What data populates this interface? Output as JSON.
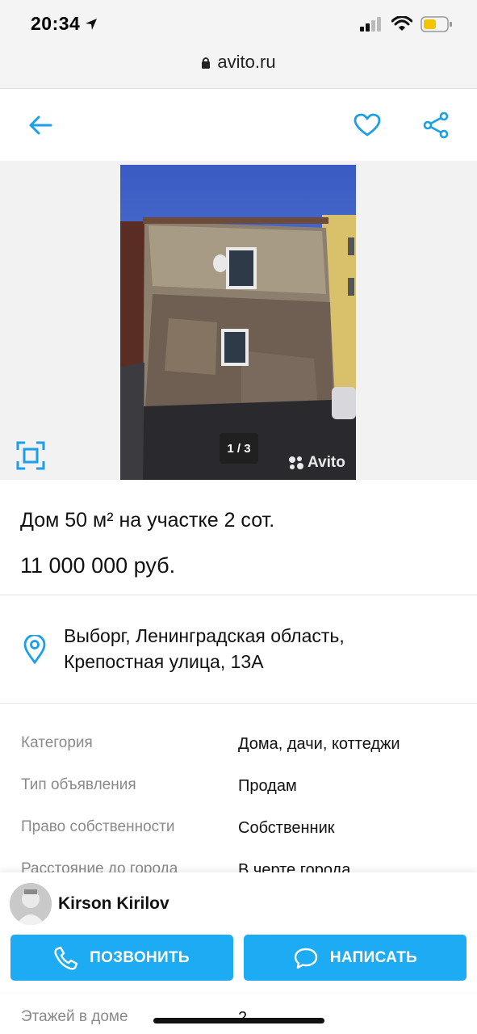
{
  "status_bar": {
    "time": "20:34"
  },
  "browser": {
    "url": "avito.ru"
  },
  "listing": {
    "photo_counter": "1 / 3",
    "watermark": "Avito",
    "title": "Дом 50 м² на участке 2 сот.",
    "price": "11 000 000 руб.",
    "address_line1": "Выборг, Ленинградская область,",
    "address_line2": "Крепостная улица, 13А",
    "params": [
      {
        "key": "Категория",
        "value": "Дома, дачи, коттеджи"
      },
      {
        "key": "Тип объявления",
        "value": "Продам"
      },
      {
        "key": "Право собственности",
        "value": "Собственник"
      },
      {
        "key": "Расстояние до города",
        "value": "В черте города"
      },
      {
        "key": "Этажей в доме",
        "value": "2"
      }
    ]
  },
  "seller": {
    "name": "Kirson Kirilov",
    "call_label": "ПОЗВОНИТЬ",
    "write_label": "НАПИСАТЬ"
  },
  "colors": {
    "accent": "#1dacf3",
    "icon_blue": "#1a9fe8"
  }
}
